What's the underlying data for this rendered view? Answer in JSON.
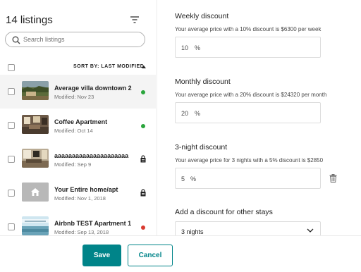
{
  "listings_panel": {
    "title": "14 listings",
    "search_placeholder": "Search listings",
    "sort_label": "SORT BY: LAST MODIFIED",
    "items": [
      {
        "name": "Average villa downtown 2",
        "modified": "Modified: Nov 23",
        "status": "listed",
        "status_color": "#2aa53c",
        "thumb": "landscape"
      },
      {
        "name": "Coffee Apartment",
        "modified": "Modified: Oct 14",
        "status": "listed",
        "status_color": "#2aa53c",
        "thumb": "interior"
      },
      {
        "name": "aaaaaaaaaaaaaaaaaaaaa",
        "modified": "Modified: Sep 9",
        "status": "in-progress",
        "status_color": "#222222",
        "thumb": "interior"
      },
      {
        "name": "Your Entire home/apt",
        "modified": "Modified: Nov 1, 2018",
        "status": "in-progress",
        "status_color": "#222222",
        "thumb": "placeholder-home"
      },
      {
        "name": "Airbnb TEST Apartment 1",
        "modified": "Modified: Sep 13, 2018",
        "status": "unlisted",
        "status_color": "#d93a30",
        "thumb": "sky"
      }
    ]
  },
  "discounts": {
    "weekly": {
      "heading": "Weekly discount",
      "hint": "Your average price with a 10% discount is $6300 per week",
      "value": "10",
      "unit": "%"
    },
    "monthly": {
      "heading": "Monthly discount",
      "hint": "Your average price with a 20% discount is $24320 per month",
      "value": "20",
      "unit": "%"
    },
    "three_night": {
      "heading": "3-night discount",
      "hint": "Your average price for 3 nights with a 5% discount is $2850",
      "value": "5",
      "unit": "%"
    },
    "other": {
      "heading": "Add a discount for other stays",
      "selected": "3 nights"
    }
  },
  "footer": {
    "save_label": "Save",
    "cancel_label": "Cancel"
  },
  "colors": {
    "accent": "#008489",
    "listed": "#2aa53c",
    "unlisted": "#d93a30"
  },
  "icons": [
    "filter-icon",
    "search-icon",
    "sort-arrow-icon",
    "lock-icon",
    "trash-icon",
    "chevron-down-icon",
    "home-icon"
  ]
}
